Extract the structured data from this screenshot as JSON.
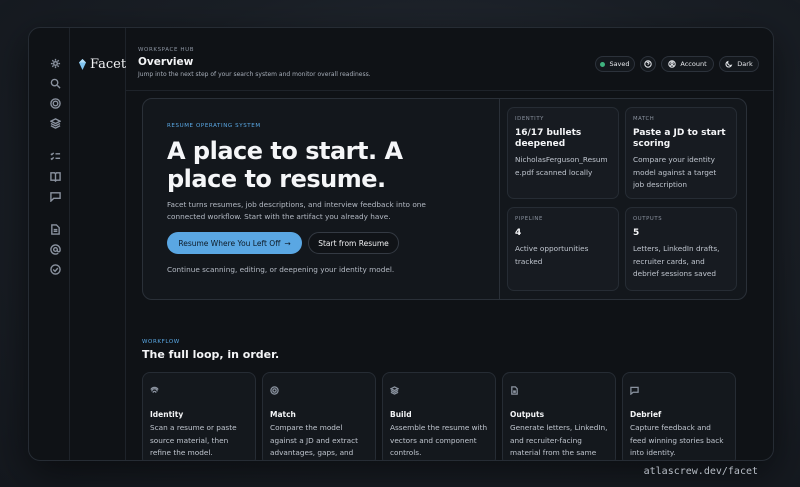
{
  "app": {
    "brand": "Facet"
  },
  "header": {
    "eyebrow": "WORKSPACE HUB",
    "title": "Overview",
    "subtitle": "Jump into the next step of your search system and monitor overall readiness.",
    "saved_label": "Saved",
    "account_label": "Account",
    "theme_label": "Dark",
    "status_color": "#3fb37f"
  },
  "rail": {
    "icons": [
      "settings-icon",
      "search-icon",
      "target-icon",
      "layers-icon",
      "checklist-icon",
      "book-icon",
      "chat-icon",
      "document-icon",
      "at-icon",
      "check-circle-icon"
    ]
  },
  "hero": {
    "kicker": "RESUME OPERATING SYSTEM",
    "title": "A place to start. A place to resume.",
    "description": "Facet turns resumes, job descriptions, and interview feedback into one connected workflow. Start with the artifact you already have.",
    "primary_label": "Resume Where You Left Off",
    "primary_arrow": "→",
    "secondary_label": "Start from Resume",
    "note": "Continue scanning, editing, or deepening your identity model.",
    "accent_color": "#5aa7e3"
  },
  "stats": [
    {
      "label": "IDENTITY",
      "value": "16/17 bullets deepened",
      "text": "NicholasFerguson_Resume.pdf scanned locally"
    },
    {
      "label": "MATCH",
      "value": "Paste a JD to start scoring",
      "text": "Compare your identity model against a target job description"
    },
    {
      "label": "PIPELINE",
      "value": "4",
      "text": "Active opportunities tracked"
    },
    {
      "label": "OUTPUTS",
      "value": "5",
      "text": "Letters, LinkedIn drafts, recruiter cards, and debrief sessions saved"
    }
  ],
  "workflow": {
    "kicker": "WORKFLOW",
    "title": "The full loop, in order.",
    "cards": [
      {
        "title": "Identity",
        "desc": "Scan a resume or paste source material, then refine the model.",
        "icon": "fingerprint-icon"
      },
      {
        "title": "Match",
        "desc": "Compare the model against a JD and extract advantages, gaps, and positioning.",
        "icon": "target-icon"
      },
      {
        "title": "Build",
        "desc": "Assemble the resume with vectors and component controls.",
        "icon": "layers-icon"
      },
      {
        "title": "Outputs",
        "desc": "Generate letters, LinkedIn, and recruiter-facing material from the same source of truth.",
        "icon": "document-icon"
      },
      {
        "title": "Debrief",
        "desc": "Capture feedback and feed winning stories back into identity.",
        "icon": "chat-icon"
      }
    ]
  },
  "footer": {
    "url": "atlascrew.dev/facet"
  }
}
